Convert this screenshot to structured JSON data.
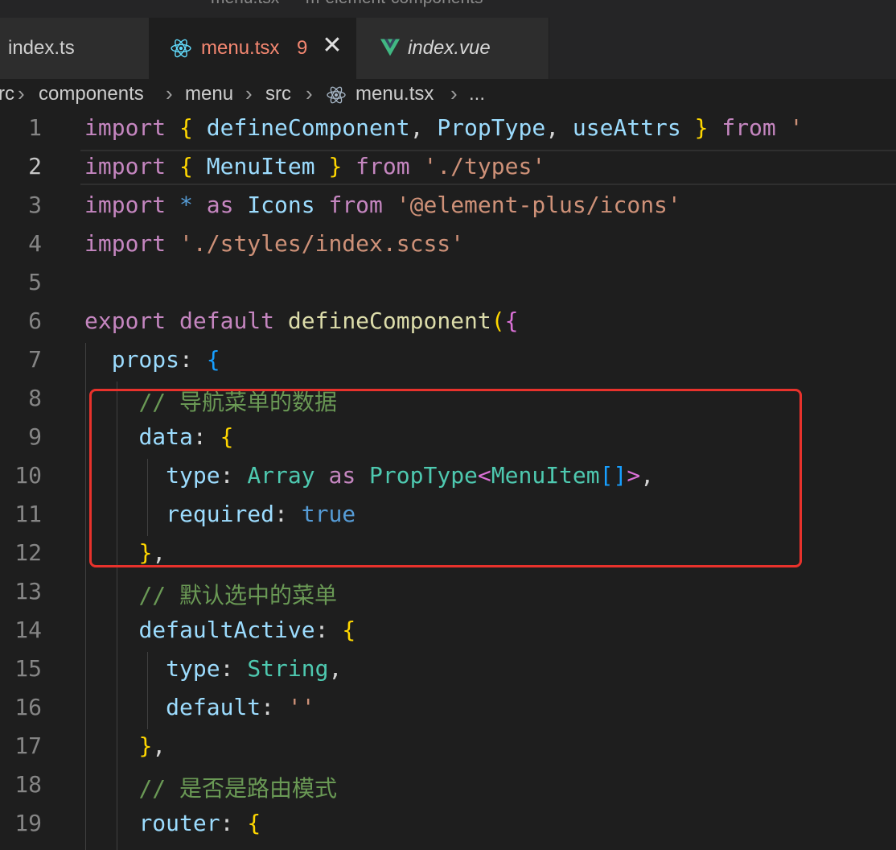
{
  "window": {
    "title": "menu.tsx — m-element-components"
  },
  "tabs": [
    {
      "label": "index.ts"
    },
    {
      "label": "menu.tsx",
      "count": "9",
      "close_glyph": "✕"
    },
    {
      "label": "index.vue"
    }
  ],
  "breadcrumb": [
    "rc",
    "components",
    "menu",
    "src",
    "menu.tsx",
    "..."
  ],
  "editor": {
    "current_line": 2,
    "lines": [
      {
        "n": "1",
        "tokens": [
          [
            "import",
            "kw"
          ],
          [
            " ",
            "op"
          ],
          [
            "{",
            "br1"
          ],
          [
            " ",
            "op"
          ],
          [
            "defineComponent",
            "id"
          ],
          [
            ", ",
            "op"
          ],
          [
            "PropType",
            "id"
          ],
          [
            ", ",
            "op"
          ],
          [
            "useAttrs",
            "id"
          ],
          [
            " ",
            "op"
          ],
          [
            "}",
            "br1"
          ],
          [
            " ",
            "op"
          ],
          [
            "from",
            "kw"
          ],
          [
            " '",
            "str"
          ]
        ]
      },
      {
        "n": "2",
        "tokens": [
          [
            "import",
            "kw"
          ],
          [
            " ",
            "op"
          ],
          [
            "{",
            "br1"
          ],
          [
            " ",
            "op"
          ],
          [
            "MenuItem",
            "id"
          ],
          [
            " ",
            "op"
          ],
          [
            "}",
            "br1"
          ],
          [
            " ",
            "op"
          ],
          [
            "from",
            "kw"
          ],
          [
            " ",
            "op"
          ],
          [
            "'./types'",
            "str"
          ]
        ]
      },
      {
        "n": "3",
        "tokens": [
          [
            "import",
            "kw"
          ],
          [
            " ",
            "op"
          ],
          [
            "*",
            "bool"
          ],
          [
            " ",
            "op"
          ],
          [
            "as",
            "kw"
          ],
          [
            " ",
            "op"
          ],
          [
            "Icons",
            "id"
          ],
          [
            " ",
            "op"
          ],
          [
            "from",
            "kw"
          ],
          [
            " ",
            "op"
          ],
          [
            "'@element-plus/icons'",
            "str"
          ]
        ]
      },
      {
        "n": "4",
        "tokens": [
          [
            "import",
            "kw"
          ],
          [
            " ",
            "op"
          ],
          [
            "'./styles/index.scss'",
            "str"
          ]
        ]
      },
      {
        "n": "5",
        "tokens": []
      },
      {
        "n": "6",
        "tokens": [
          [
            "export",
            "kw"
          ],
          [
            " ",
            "op"
          ],
          [
            "default",
            "kw"
          ],
          [
            " ",
            "op"
          ],
          [
            "defineComponent",
            "fn"
          ],
          [
            "(",
            "br1"
          ],
          [
            "{",
            "br2"
          ]
        ]
      },
      {
        "n": "7",
        "tokens": [
          [
            "  ",
            "op"
          ],
          [
            "props",
            "id"
          ],
          [
            ": ",
            "op"
          ],
          [
            "{",
            "br3"
          ]
        ]
      },
      {
        "n": "8",
        "tokens": [
          [
            "    ",
            "op"
          ],
          [
            "// 导航菜单的数据",
            "cm"
          ]
        ]
      },
      {
        "n": "9",
        "tokens": [
          [
            "    ",
            "op"
          ],
          [
            "data",
            "id"
          ],
          [
            ": ",
            "op"
          ],
          [
            "{",
            "br1"
          ]
        ]
      },
      {
        "n": "10",
        "tokens": [
          [
            "      ",
            "op"
          ],
          [
            "type",
            "id"
          ],
          [
            ": ",
            "op"
          ],
          [
            "Array",
            "ty"
          ],
          [
            " ",
            "op"
          ],
          [
            "as",
            "kw"
          ],
          [
            " ",
            "op"
          ],
          [
            "PropType",
            "ty"
          ],
          [
            "<",
            "br2"
          ],
          [
            "MenuItem",
            "ty"
          ],
          [
            "[]",
            "br3"
          ],
          [
            ">",
            "br2"
          ],
          [
            ",",
            "op"
          ]
        ]
      },
      {
        "n": "11",
        "tokens": [
          [
            "      ",
            "op"
          ],
          [
            "required",
            "id"
          ],
          [
            ": ",
            "op"
          ],
          [
            "true",
            "bool"
          ]
        ]
      },
      {
        "n": "12",
        "tokens": [
          [
            "    ",
            "op"
          ],
          [
            "}",
            "br1"
          ],
          [
            ",",
            "op"
          ]
        ]
      },
      {
        "n": "13",
        "tokens": [
          [
            "    ",
            "op"
          ],
          [
            "// 默认选中的菜单",
            "cm"
          ]
        ]
      },
      {
        "n": "14",
        "tokens": [
          [
            "    ",
            "op"
          ],
          [
            "defaultActive",
            "id"
          ],
          [
            ": ",
            "op"
          ],
          [
            "{",
            "br1"
          ]
        ]
      },
      {
        "n": "15",
        "tokens": [
          [
            "      ",
            "op"
          ],
          [
            "type",
            "id"
          ],
          [
            ": ",
            "op"
          ],
          [
            "String",
            "ty"
          ],
          [
            ",",
            "op"
          ]
        ]
      },
      {
        "n": "16",
        "tokens": [
          [
            "      ",
            "op"
          ],
          [
            "default",
            "id"
          ],
          [
            ": ",
            "op"
          ],
          [
            "''",
            "str"
          ]
        ]
      },
      {
        "n": "17",
        "tokens": [
          [
            "    ",
            "op"
          ],
          [
            "}",
            "br1"
          ],
          [
            ",",
            "op"
          ]
        ]
      },
      {
        "n": "18",
        "tokens": [
          [
            "    ",
            "op"
          ],
          [
            "// 是否是路由模式",
            "cm"
          ]
        ]
      },
      {
        "n": "19",
        "tokens": [
          [
            "    ",
            "op"
          ],
          [
            "router",
            "id"
          ],
          [
            ": ",
            "op"
          ],
          [
            "{",
            "br1"
          ]
        ]
      }
    ]
  },
  "icons": {
    "tab_menu_icon": "react-icon",
    "tab_vue_icon": "vue-icon",
    "breadcrumb_file_icon": "react-icon"
  },
  "colors": {
    "background": "#1e1e1e",
    "error_tab_label": "#f48771",
    "highlight_box": "#e8322c"
  }
}
